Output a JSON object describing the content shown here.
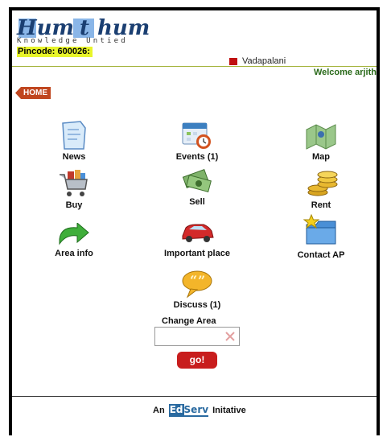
{
  "header": {
    "logo_word_1": "Hum",
    "logo_word_2": "t",
    "logo_word_3": "hum",
    "tagline": "Knowledge Untied",
    "pincode": "Pincode: 600026:",
    "area_name": "Vadapalani",
    "welcome": "Welcome arjith"
  },
  "nav": {
    "home": "HOME"
  },
  "menu": {
    "news": "News",
    "events": "Events (1)",
    "map": "Map",
    "buy": "Buy",
    "sell": "Sell",
    "rent": "Rent",
    "area_info": "Area info",
    "important_place": "Important place",
    "contact_ap": "Contact AP",
    "discuss": "Discuss (1)"
  },
  "change_area": {
    "label": "Change Area",
    "input_value": "",
    "go": "go!"
  },
  "footer": {
    "prefix": "An",
    "brand_e": "Ed",
    "brand_rest": "Serv",
    "suffix": "Initative"
  },
  "colors": {
    "accent_red": "#c81d1d",
    "home_orange": "#c0461f",
    "pincode_bg": "#e8f52a",
    "welcome_green": "#2a6a1a"
  }
}
